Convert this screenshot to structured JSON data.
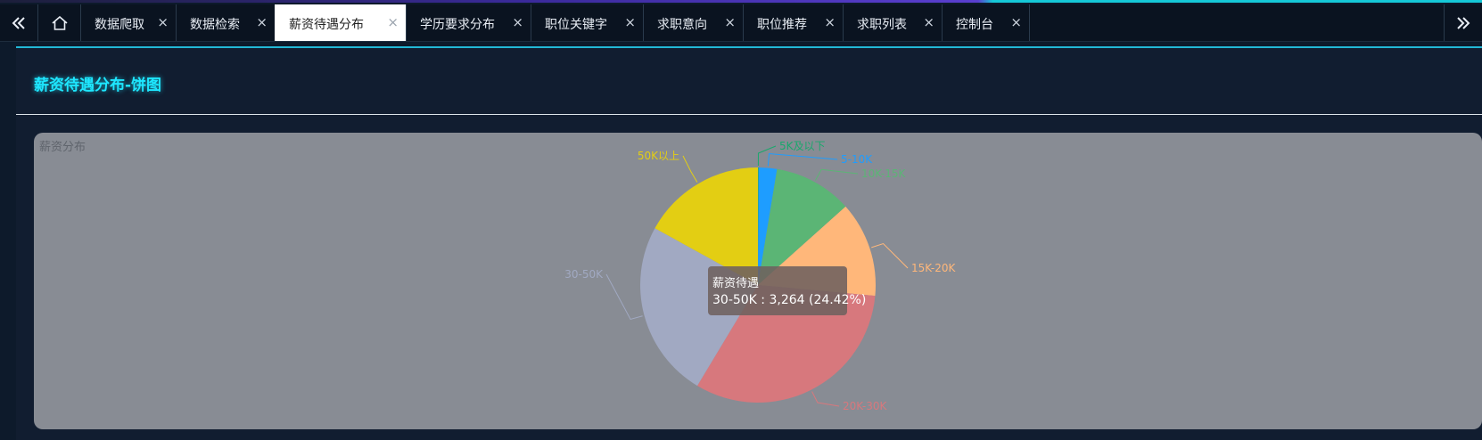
{
  "tabs": [
    {
      "label": "数据爬取",
      "active": false
    },
    {
      "label": "数据检索",
      "active": false
    },
    {
      "label": "薪资待遇分布",
      "active": true
    },
    {
      "label": "学历要求分布",
      "active": false
    },
    {
      "label": "职位关键字",
      "active": false
    },
    {
      "label": "求职意向",
      "active": false
    },
    {
      "label": "职位推荐",
      "active": false
    },
    {
      "label": "求职列表",
      "active": false
    },
    {
      "label": "控制台",
      "active": false
    }
  ],
  "tab_close_glyph": "×",
  "icons": {
    "nav_left": "double-chevron-left-icon",
    "home": "home-icon",
    "nav_right": "double-chevron-right-icon"
  },
  "panel": {
    "title": "薪资待遇分布-饼图"
  },
  "chart_data": {
    "type": "pie",
    "title": "薪资分布",
    "series_name": "薪资待遇",
    "slices": [
      {
        "label": "5K及以下",
        "value": 13,
        "color": "#1aa86d"
      },
      {
        "label": "5-10K",
        "value": 335,
        "color": "#1e9dff"
      },
      {
        "label": "10K-15K",
        "value": 1440,
        "color": "#5bb575"
      },
      {
        "label": "15K-20K",
        "value": 1750,
        "color": "#ffb77a"
      },
      {
        "label": "20K-30K",
        "value": 4300,
        "color": "#d7787d"
      },
      {
        "label": "30-50K",
        "value": 3264,
        "color": "#a1a9c2"
      },
      {
        "label": "50K以上",
        "value": 2270,
        "color": "#e3ce13"
      }
    ],
    "tooltip": {
      "title": "薪资待遇",
      "text": "30-50K : 3,264 (24.42%)"
    }
  }
}
